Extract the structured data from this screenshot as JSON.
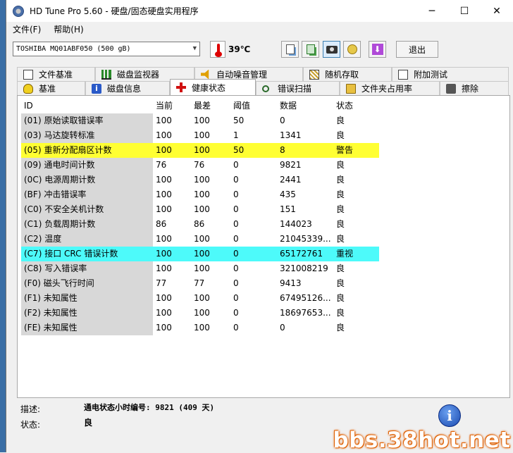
{
  "window": {
    "title": "HD Tune Pro 5.60 - 硬盘/固态硬盘实用程序",
    "min": "─",
    "max": "☐",
    "close": "✕"
  },
  "menu": [
    "文件(F)",
    "帮助(H)"
  ],
  "toolbar": {
    "drive": "TOSHIBA MQ01ABF050 (500 gB)",
    "temperature": "39℃",
    "exit_label": "退出"
  },
  "tabs_row1": [
    {
      "label": "文件基准",
      "icon": "document-icon"
    },
    {
      "label": "磁盘监视器",
      "icon": "bar-chart-icon"
    },
    {
      "label": "自动噪音管理",
      "icon": "speaker-icon"
    },
    {
      "label": "随机存取",
      "icon": "random-grid-icon"
    },
    {
      "label": "附加测试",
      "icon": "test-icon"
    }
  ],
  "tabs_row2": [
    {
      "label": "基准",
      "icon": "lightbulb-icon"
    },
    {
      "label": "磁盘信息",
      "icon": "info-icon"
    },
    {
      "label": "健康状态",
      "icon": "health-cross-icon",
      "active": true
    },
    {
      "label": "错误扫描",
      "icon": "magnifier-icon"
    },
    {
      "label": "文件夹占用率",
      "icon": "folder-icon"
    },
    {
      "label": "擦除",
      "icon": "eraser-icon"
    }
  ],
  "table": {
    "headers": [
      "ID",
      "当前",
      "最差",
      "阈值",
      "数据",
      "状态"
    ],
    "rows": [
      {
        "id": "(01) 原始读取错误率",
        "cur": "100",
        "worst": "100",
        "thr": "50",
        "data": "0",
        "status": "良"
      },
      {
        "id": "(03) 马达旋转标准",
        "cur": "100",
        "worst": "100",
        "thr": "1",
        "data": "1341",
        "status": "良"
      },
      {
        "id": "(05) 重新分配扇区计数",
        "cur": "100",
        "worst": "100",
        "thr": "50",
        "data": "8",
        "status": "警告"
      },
      {
        "id": "(09) 通电时间计数",
        "cur": "76",
        "worst": "76",
        "thr": "0",
        "data": "9821",
        "status": "良"
      },
      {
        "id": "(0C) 电源周期计数",
        "cur": "100",
        "worst": "100",
        "thr": "0",
        "data": "2441",
        "status": "良"
      },
      {
        "id": "(BF) 冲击错误率",
        "cur": "100",
        "worst": "100",
        "thr": "0",
        "data": "435",
        "status": "良"
      },
      {
        "id": "(C0) 不安全关机计数",
        "cur": "100",
        "worst": "100",
        "thr": "0",
        "data": "151",
        "status": "良"
      },
      {
        "id": "(C1) 负载周期计数",
        "cur": "86",
        "worst": "86",
        "thr": "0",
        "data": "144023",
        "status": "良"
      },
      {
        "id": "(C2) 温度",
        "cur": "100",
        "worst": "100",
        "thr": "0",
        "data": "21045339...",
        "status": "良"
      },
      {
        "id": "(C7) 接口 CRC 错误计数",
        "cur": "100",
        "worst": "100",
        "thr": "0",
        "data": "65172761",
        "status": "重视"
      },
      {
        "id": "(C8) 写入错误率",
        "cur": "100",
        "worst": "100",
        "thr": "0",
        "data": "321008219",
        "status": "良"
      },
      {
        "id": "(F0) 磁头飞行时间",
        "cur": "77",
        "worst": "77",
        "thr": "0",
        "data": "9413",
        "status": "良"
      },
      {
        "id": "(F1) 未知属性",
        "cur": "100",
        "worst": "100",
        "thr": "0",
        "data": "67495126...",
        "status": "良"
      },
      {
        "id": "(F2) 未知属性",
        "cur": "100",
        "worst": "100",
        "thr": "0",
        "data": "18697653...",
        "status": "良"
      },
      {
        "id": "(FE) 未知属性",
        "cur": "100",
        "worst": "100",
        "thr": "0",
        "data": "0",
        "status": "良"
      }
    ],
    "warn_color": "#ffff33",
    "caution_color": "#4dfafa"
  },
  "bottom": {
    "desc_label": "描述:",
    "desc_value": "通电状态小时编号: 9821 (409 天)",
    "status_label": "状态:",
    "status_value": "良",
    "info_glyph": "i"
  },
  "watermark": "bbs.38hot.net"
}
